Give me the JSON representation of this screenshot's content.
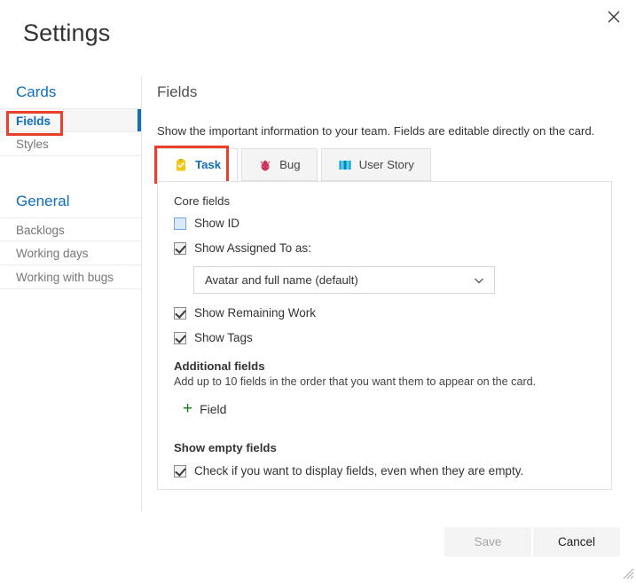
{
  "window": {
    "title": "Settings",
    "close_icon": "close-icon",
    "resize_grip": "resize-grip"
  },
  "sidebar": {
    "groups": [
      {
        "title": "Cards",
        "items": [
          {
            "label": "Fields",
            "selected": true,
            "highlighted": true
          },
          {
            "label": "Styles",
            "selected": false,
            "highlighted": false
          }
        ]
      },
      {
        "title": "General",
        "items": [
          {
            "label": "Backlogs",
            "selected": false,
            "highlighted": false
          },
          {
            "label": "Working days",
            "selected": false,
            "highlighted": false
          },
          {
            "label": "Working with bugs",
            "selected": false,
            "highlighted": false
          }
        ]
      }
    ]
  },
  "main": {
    "heading": "Fields",
    "description": "Show the important information to your team. Fields are editable directly on the card.",
    "tabs": [
      {
        "label": "Task",
        "icon": "task-clipboard-icon",
        "active": true,
        "highlighted": true
      },
      {
        "label": "Bug",
        "icon": "bug-ladybug-icon",
        "active": false,
        "highlighted": false
      },
      {
        "label": "User Story",
        "icon": "user-story-book-icon",
        "active": false,
        "highlighted": false
      }
    ],
    "core_fields": {
      "label": "Core fields",
      "show_id": {
        "label": "Show ID",
        "checked": false
      },
      "show_assigned_to": {
        "label": "Show Assigned To as:",
        "checked": true
      },
      "assigned_to_select": {
        "value": "Avatar and full name (default)",
        "icon": "chevron-down-icon"
      },
      "show_remaining_work": {
        "label": "Show Remaining Work",
        "checked": true
      },
      "show_tags": {
        "label": "Show Tags",
        "checked": true
      }
    },
    "additional_fields": {
      "label": "Additional fields",
      "description": "Add up to 10 fields in the order that you want them to appear on the card.",
      "add_label": "Field",
      "add_icon": "plus-icon"
    },
    "show_empty_fields": {
      "label": "Show empty fields",
      "checkbox_label": "Check if you want to display fields, even when they are empty.",
      "checked": true
    }
  },
  "footer": {
    "save_label": "Save",
    "save_disabled": true,
    "cancel_label": "Cancel"
  },
  "colors": {
    "accent_blue": "#106ebe",
    "highlight_red": "#e8402a",
    "plus_green": "#107c10",
    "task_yellow": "#f2c811",
    "bug_red": "#e04a6e",
    "story_blue": "#009ccc"
  }
}
